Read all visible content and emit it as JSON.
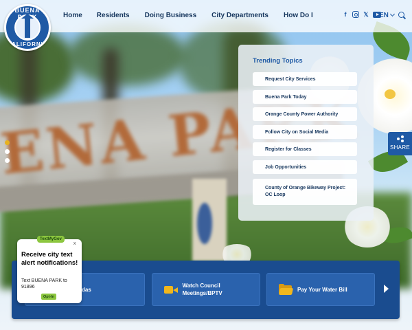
{
  "logo": {
    "top_text": "BUENA PARK",
    "bottom_text": "CALIFORNIA"
  },
  "nav": {
    "items": [
      {
        "label": "Home"
      },
      {
        "label": "Residents"
      },
      {
        "label": "Doing Business"
      },
      {
        "label": "City Departments"
      },
      {
        "label": "How Do I"
      }
    ]
  },
  "header": {
    "social_icons": [
      "facebook-icon",
      "instagram-icon",
      "x-icon",
      "youtube-icon"
    ],
    "language_label": "EN",
    "search_icon": "search-icon"
  },
  "hero": {
    "sign_text": "ENA PARK",
    "slider": {
      "count": 3,
      "active_index": 0
    }
  },
  "trending": {
    "title": "Trending Topics",
    "topics": [
      {
        "label": "Request City Services"
      },
      {
        "label": "Buena Park Today"
      },
      {
        "label": "Orange County Power Authority"
      },
      {
        "label": "Follow City on Social Media"
      },
      {
        "label": "Register for Classes"
      },
      {
        "label": "Job Opportunities"
      },
      {
        "label": "County of Orange Bikeway Project: OC Loop"
      }
    ]
  },
  "share": {
    "label": "SHARE"
  },
  "quick_links": {
    "items": [
      {
        "label": "das",
        "icon": ""
      },
      {
        "label": "Watch Council Meetings/BPTV",
        "icon": "video-camera-icon"
      },
      {
        "label": "Pay Your Water Bill",
        "icon": "folder-icon"
      }
    ],
    "next_icon": "chevron-right-icon"
  },
  "textmygov": {
    "badge": "TextMyGov",
    "close": "x",
    "headline": "Receive city text alert notifications!",
    "body": "Text BUENA PARK to 91896",
    "opt_in": "Opt-In"
  },
  "colors": {
    "brand_blue": "#1f5aa5",
    "nav_text": "#17375e",
    "accent_gold": "#e7b21f",
    "quickbar_bg": "#1a4c8f",
    "tmg_green": "#8cc63f"
  }
}
